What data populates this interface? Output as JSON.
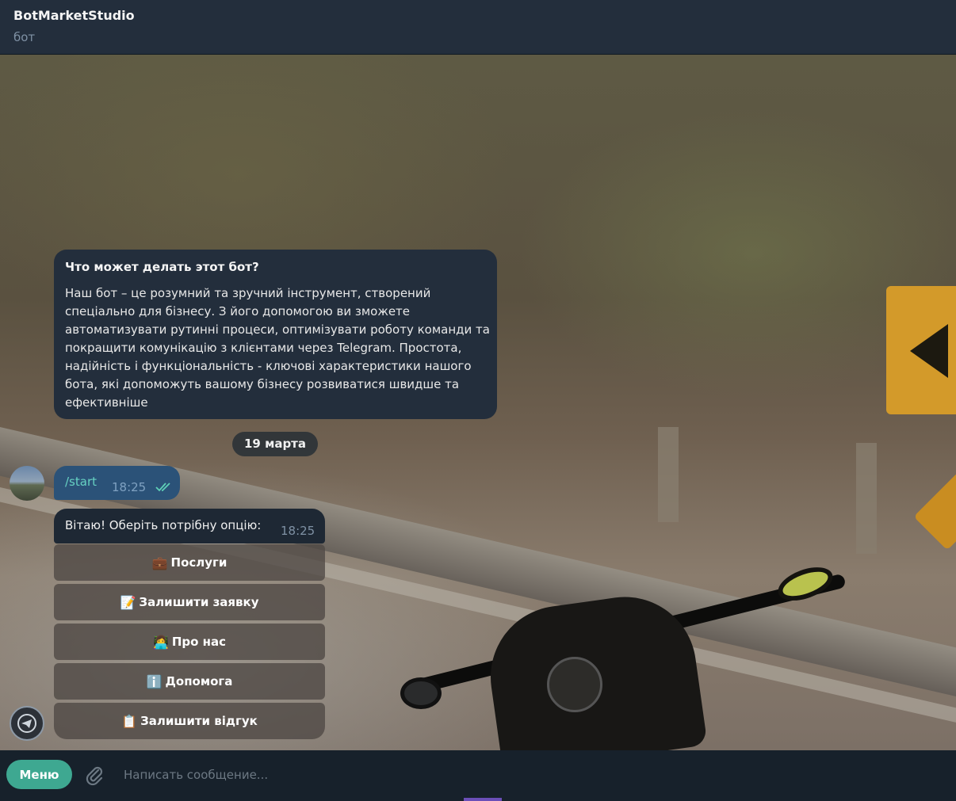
{
  "header": {
    "title": "BotMarketStudio",
    "subtitle": "бот"
  },
  "info": {
    "title": "Что может делать этот бот?",
    "text": "Наш бот – це розумний та зручний інструмент, створений спеціально для бізнесу. З його допомогою ви зможете автоматизувати рутинні процеси, оптимізувати роботу команди та покращити комунікацію з клієнтами через Telegram. Простота, надійність і функціональність - ключові характеристики нашого бота, які допоможуть вашому бізнесу розвиватися швидше та ефективніше"
  },
  "date_label": "19 марта",
  "outgoing": {
    "text": "/start",
    "time": "18:25"
  },
  "incoming": {
    "text": "Вітаю! Оберіть потрібну опцію:",
    "time": "18:25"
  },
  "keyboard": [
    {
      "icon": "💼",
      "label": "Послуги"
    },
    {
      "icon": "📝",
      "label": "Залишити заявку"
    },
    {
      "icon": "👩‍💻",
      "label": "Про нас"
    },
    {
      "icon": "ℹ️",
      "label": "Допомога"
    },
    {
      "icon": "📋",
      "label": "Залишити відгук"
    }
  ],
  "composer": {
    "menu_label": "Меню",
    "placeholder": "Написать сообщение..."
  },
  "colors": {
    "accent": "#3ea891",
    "header_bg": "#232e3c",
    "outgoing_bg": "#2b5278"
  }
}
